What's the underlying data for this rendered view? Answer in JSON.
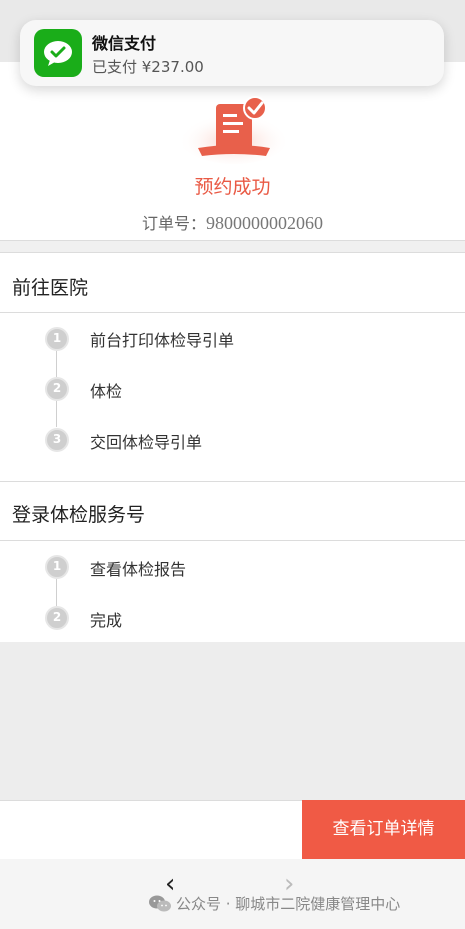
{
  "notification": {
    "app_name": "微信支付",
    "message": "已支付 ¥237.00",
    "icon": "wechat-pay-icon",
    "accent": "#1aad19"
  },
  "success": {
    "icon": "receipt-check-icon",
    "text": "预约成功",
    "order_label": "订单号：",
    "order_number": "9800000002060",
    "accent": "#e95a45"
  },
  "section_hospital": {
    "title": "前往医院",
    "steps": [
      {
        "num": "1",
        "label": "前台打印体检导引单"
      },
      {
        "num": "2",
        "label": "体检"
      },
      {
        "num": "3",
        "label": "交回体检导引单"
      }
    ]
  },
  "section_service": {
    "title": "登录体检服务号",
    "steps": [
      {
        "num": "1",
        "label": "查看体检报告"
      },
      {
        "num": "2",
        "label": "完成"
      }
    ]
  },
  "action": {
    "detail_button": "查看订单详情",
    "color": "#f05a45"
  },
  "footer": {
    "back_icon": "chevron-left-icon",
    "forward_icon": "chevron-right-icon",
    "watermark": "公众号 · 聊城市二院健康管理中心"
  }
}
